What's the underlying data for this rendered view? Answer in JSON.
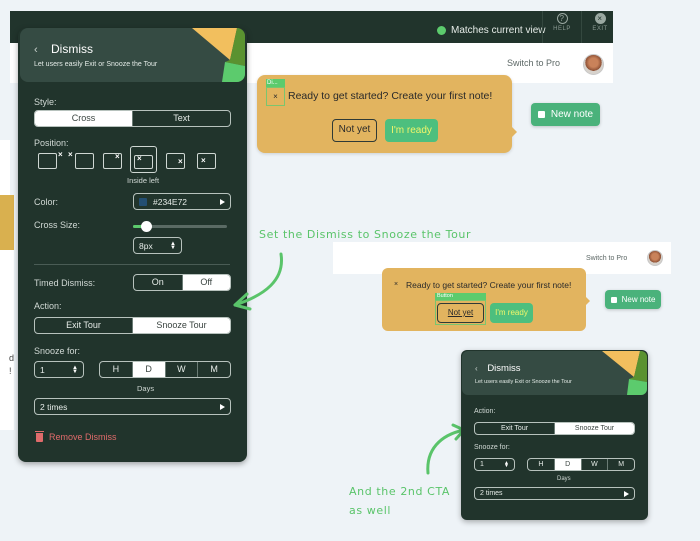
{
  "app": {
    "status_text": "Matches current view",
    "help_label": "HELP",
    "exit_label": "EXIT",
    "switch_pro": "Switch to Pro",
    "left_partial_text": [
      "d",
      "!"
    ]
  },
  "tooltip": {
    "tag": "Di...",
    "close": "×",
    "text": "Ready to get started? Create your first note!",
    "secondary_button": "Not yet",
    "primary_button": "I'm ready"
  },
  "new_note_button": "New note",
  "panel": {
    "back": "‹",
    "title": "Dismiss",
    "subtitle": "Let users easily Exit or Snooze the Tour",
    "style_label": "Style:",
    "style_options": [
      {
        "label": "Cross",
        "selected": true
      },
      {
        "label": "Text",
        "selected": false
      }
    ],
    "position_label": "Position:",
    "position_selected": "Inside left",
    "color_label": "Color:",
    "color_value": "#234E72",
    "cross_size_label": "Cross Size:",
    "cross_size_value": "8px",
    "cross_size_fraction": 0.1,
    "timed_dismiss_label": "Timed Dismiss:",
    "timed_dismiss_options": [
      {
        "label": "On",
        "selected": false
      },
      {
        "label": "Off",
        "selected": true
      }
    ],
    "action_label": "Action:",
    "action_options": [
      {
        "label": "Exit Tour",
        "selected": false
      },
      {
        "label": "Snooze Tour",
        "selected": true
      }
    ],
    "snooze_label": "Snooze for:",
    "snooze_amount": "1",
    "snooze_units": [
      {
        "label": "H",
        "selected": false
      },
      {
        "label": "D",
        "selected": true
      },
      {
        "label": "W",
        "selected": false
      },
      {
        "label": "M",
        "selected": false
      }
    ],
    "snooze_unit_caption": "Days",
    "repeat_value": "2 times",
    "remove_label": "Remove Dismiss"
  },
  "annotations": {
    "first": "Set the Dismiss to Snooze the Tour",
    "second_line1": "And the 2nd CTA",
    "second_line2": "as well"
  },
  "second_view": {
    "switch_pro": "Switch to Pro",
    "close": "×",
    "text": "Ready to get started? Create your first note!",
    "tag": "Button",
    "secondary_button": "Not yet",
    "primary_button": "I'm ready",
    "new_note_button": "New note",
    "panel": {
      "back": "‹",
      "title": "Dismiss",
      "subtitle": "Let users easily Exit or Snooze the Tour",
      "action_label": "Action:",
      "action_options": [
        {
          "label": "Exit Tour",
          "selected": false
        },
        {
          "label": "Snooze Tour",
          "selected": true
        }
      ],
      "snooze_label": "Snooze for:",
      "snooze_amount": "1",
      "snooze_units": [
        {
          "label": "H",
          "selected": false
        },
        {
          "label": "D",
          "selected": true
        },
        {
          "label": "W",
          "selected": false
        },
        {
          "label": "M",
          "selected": false
        }
      ],
      "snooze_unit_caption": "Days",
      "repeat_value": "2 times"
    }
  },
  "colors": {
    "panel_bg": "#21342c",
    "accent_green": "#5ccb6d",
    "tooltip_bg": "#e2b45f",
    "danger": "#e06b6b",
    "picked_color": "#234E72"
  }
}
